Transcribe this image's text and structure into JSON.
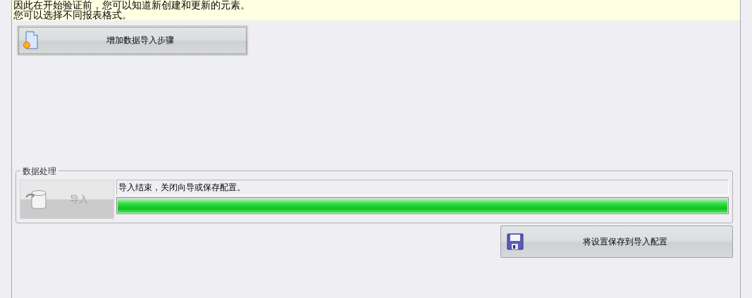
{
  "info_panel": {
    "lines": [
      "因此在开始验证前，您可以知道新创建和更新的元素。",
      "您可以选择不同报表格式。"
    ]
  },
  "add_step_button": {
    "label": "增加数据导入步骤",
    "focused": true
  },
  "data_processing": {
    "title": "数据处理",
    "import_button": {
      "label": "导入",
      "disabled": true
    },
    "status": "导入结束，关闭向导或保存配置。",
    "progress": {
      "level": 1
    }
  },
  "save_button": {
    "label": "将设置保存到导入配置"
  }
}
